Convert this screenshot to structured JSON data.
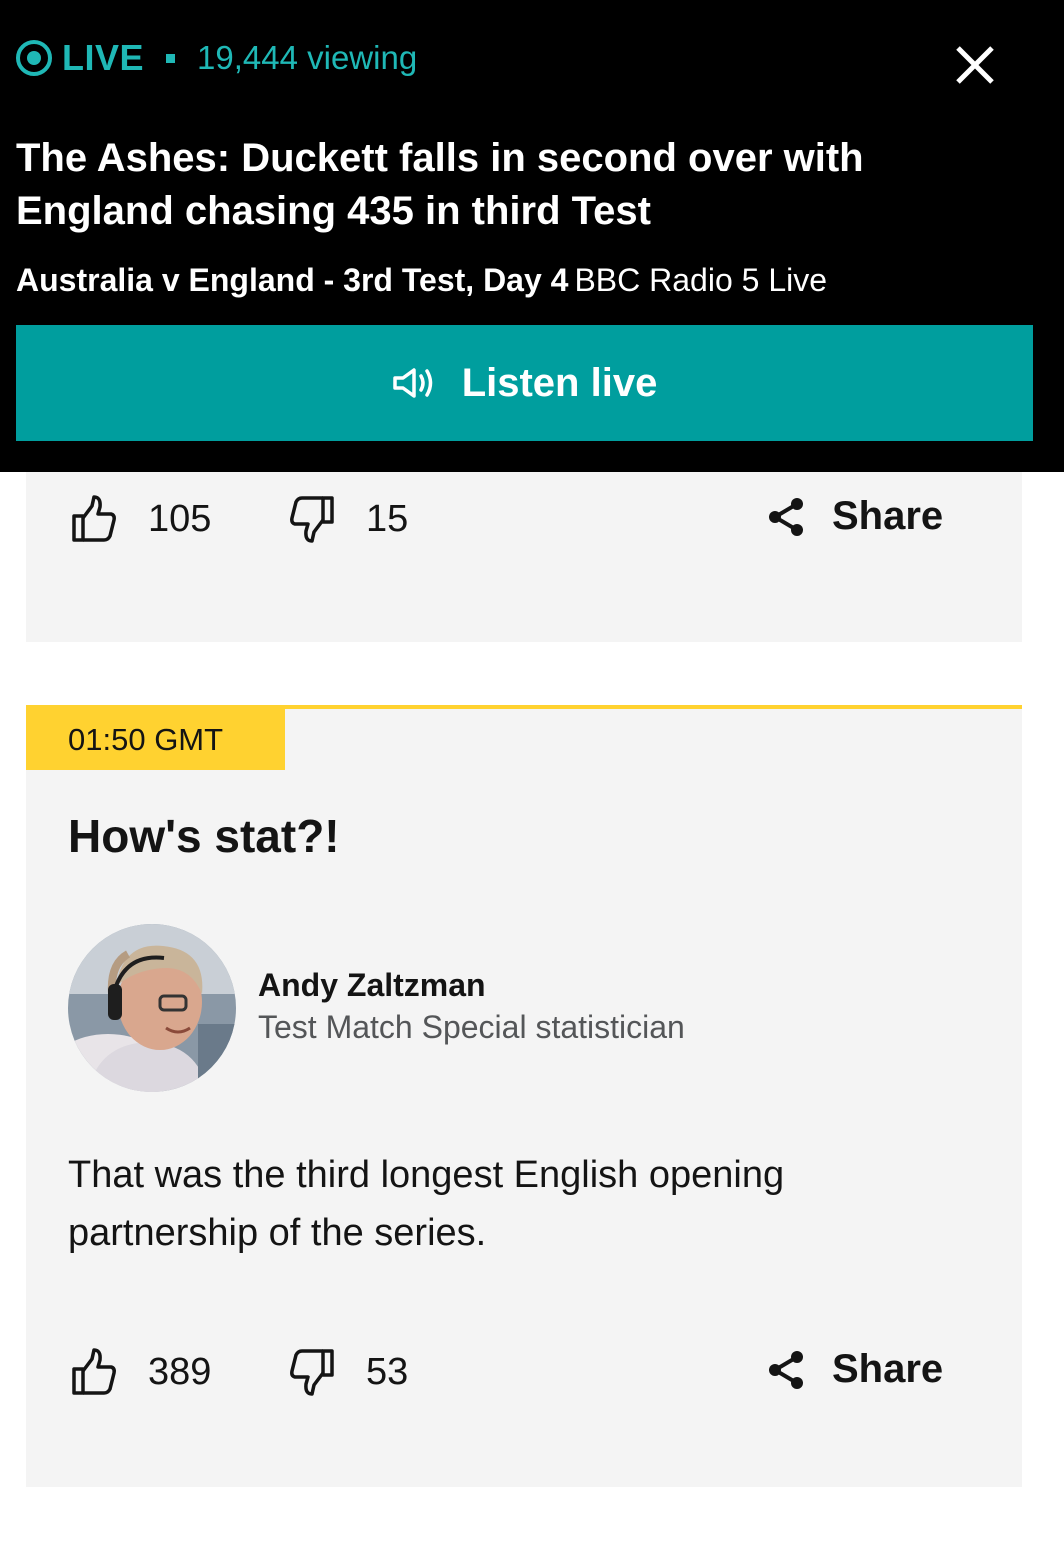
{
  "banner": {
    "live_label": "LIVE",
    "viewing": "19,444 viewing",
    "headline": "The Ashes: Duckett falls in second over with England chasing 435 in third Test",
    "match": "Australia v England - 3rd Test, Day 4",
    "station": "BBC Radio 5 Live",
    "listen_label": "Listen live",
    "accent_color": "#1fb8b6",
    "button_color": "#009e9e"
  },
  "posts": [
    {
      "likes": "105",
      "dislikes": "15",
      "share_label": "Share"
    },
    {
      "timestamp": "01:50 GMT",
      "title": "How's stat?!",
      "author_name": "Andy Zaltzman",
      "author_role": "Test Match Special statistician",
      "body": "That was the third longest English opening partnership of the series.",
      "likes": "389",
      "dislikes": "53",
      "share_label": "Share",
      "highlight_color": "#ffd230"
    }
  ],
  "icons": {
    "live": "live-indicator-icon",
    "close": "close-icon",
    "speaker": "speaker-icon",
    "like": "thumbs-up-icon",
    "dislike": "thumbs-down-icon",
    "share": "share-icon"
  }
}
